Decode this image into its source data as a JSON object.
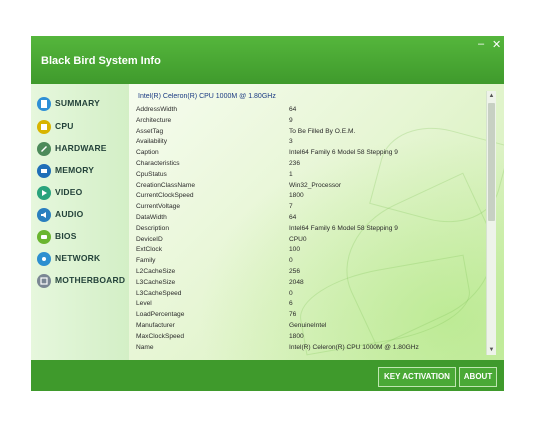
{
  "window": {
    "title": "Black Bird System Info",
    "minimize_label": "–",
    "close_label": "✕"
  },
  "sidebar": {
    "items": [
      {
        "label": "SUMMARY",
        "icon": "summary-icon",
        "color": "#2f8fd6"
      },
      {
        "label": "CPU",
        "icon": "cpu-icon",
        "color": "#d8b400"
      },
      {
        "label": "HARDWARE",
        "icon": "hardware-icon",
        "color": "#4c8a5a"
      },
      {
        "label": "MEMORY",
        "icon": "memory-icon",
        "color": "#1f6fb8"
      },
      {
        "label": "VIDEO",
        "icon": "video-icon",
        "color": "#29a37c"
      },
      {
        "label": "AUDIO",
        "icon": "audio-icon",
        "color": "#2a7fbf"
      },
      {
        "label": "BIOS",
        "icon": "bios-icon",
        "color": "#6ab52f"
      },
      {
        "label": "NETWORK",
        "icon": "network-icon",
        "color": "#2c8fd0"
      },
      {
        "label": "MOTHERBOARD",
        "icon": "motherboard-icon",
        "color": "#7b8794"
      }
    ]
  },
  "cpu_panel": {
    "header": "Intel(R) Celeron(R) CPU 1000M @ 1.80GHz",
    "rows": [
      {
        "name": "AddressWidth",
        "value": "64"
      },
      {
        "name": "Architecture",
        "value": "9"
      },
      {
        "name": "AssetTag",
        "value": "To Be Filled By O.E.M."
      },
      {
        "name": "Availability",
        "value": "3"
      },
      {
        "name": "Caption",
        "value": "Intel64 Family 6 Model 58 Stepping 9"
      },
      {
        "name": "Characteristics",
        "value": "236"
      },
      {
        "name": "CpuStatus",
        "value": "1"
      },
      {
        "name": "CreationClassName",
        "value": "Win32_Processor"
      },
      {
        "name": "CurrentClockSpeed",
        "value": "1800"
      },
      {
        "name": "CurrentVoltage",
        "value": "7"
      },
      {
        "name": "DataWidth",
        "value": "64"
      },
      {
        "name": "Description",
        "value": "Intel64 Family 6 Model 58 Stepping 9"
      },
      {
        "name": "DeviceID",
        "value": "CPU0"
      },
      {
        "name": "ExtClock",
        "value": "100"
      },
      {
        "name": "Family",
        "value": "0"
      },
      {
        "name": "L2CacheSize",
        "value": "256"
      },
      {
        "name": "L3CacheSize",
        "value": "2048"
      },
      {
        "name": "L3CacheSpeed",
        "value": "0"
      },
      {
        "name": "Level",
        "value": "6"
      },
      {
        "name": "LoadPercentage",
        "value": "76"
      },
      {
        "name": "Manufacturer",
        "value": "GenuineIntel"
      },
      {
        "name": "MaxClockSpeed",
        "value": "1800"
      },
      {
        "name": "Name",
        "value": "Intel(R) Celeron(R) CPU 1000M @ 1.80GHz"
      }
    ]
  },
  "footer": {
    "key_activation_label": "KEY ACTIVATION",
    "about_label": "ABOUT"
  }
}
